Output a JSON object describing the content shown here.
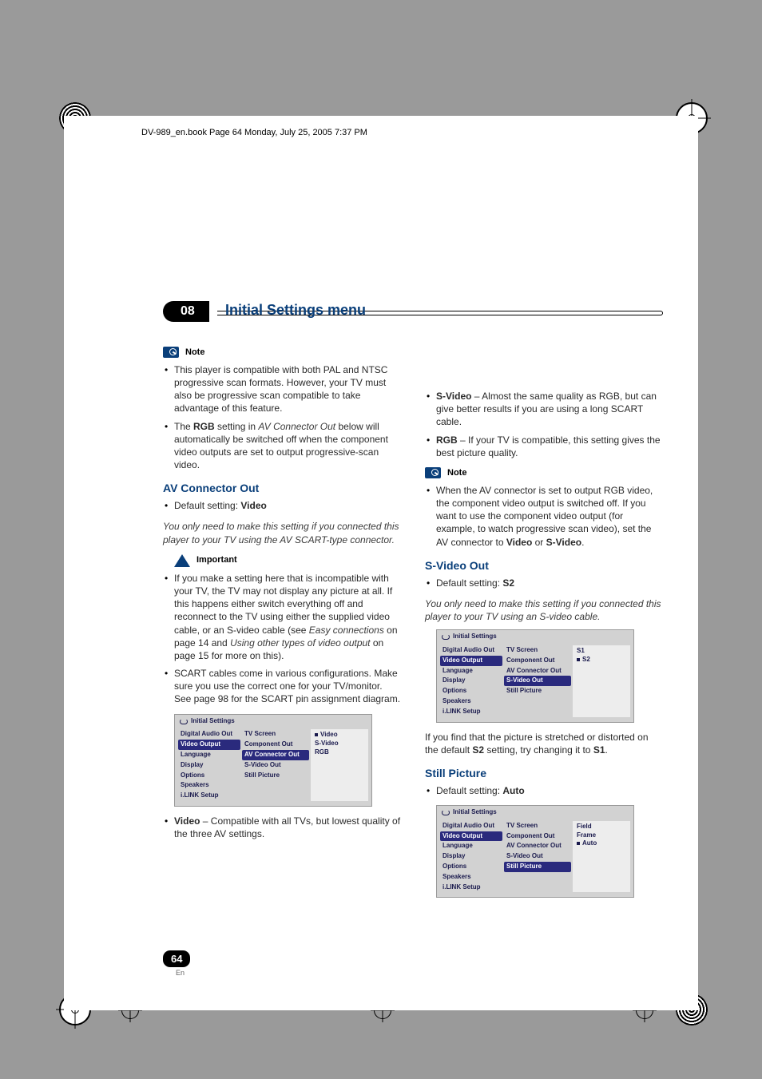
{
  "header_runner": "DV-989_en.book  Page 64  Monday, July 25, 2005  7:37 PM",
  "chapter": {
    "number": "08",
    "title": "Initial Settings menu"
  },
  "page": {
    "number": "64",
    "lang": "En"
  },
  "labels": {
    "note": "Note",
    "important": "Important"
  },
  "left": {
    "note_items": [
      {
        "pre": "This player is compatible with both PAL and NTSC progressive scan formats. However, your TV must also be progressive scan compatible to take advantage of this feature."
      },
      {
        "pre": "The ",
        "b1": "RGB",
        "mid1": " setting in ",
        "i1": "AV Connector Out",
        "post": " below will automatically be switched off when the component video outputs are set to output progressive-scan video."
      }
    ],
    "avc": {
      "heading": "AV Connector Out",
      "default_pre": "Default setting: ",
      "default_val": "Video",
      "italic": "You only need to make this setting if you connected this player to your TV using the AV SCART-type connector.",
      "important_items": [
        {
          "pre": "If you make a setting here that is incompatible with your TV, the TV may not display any picture at all. If this happens either switch everything off and reconnect to the TV using either the supplied video cable, or an S-video cable (see ",
          "i1": "Easy connections",
          "mid1": " on page 14 and ",
          "i2": "Using other types of video output",
          "post": " on page 15 for more on this)."
        },
        {
          "pre": "SCART cables come in various configurations. Make sure you use the correct one for your TV/monitor. See page 98 for the SCART pin assignment diagram."
        }
      ],
      "video_bullet_b": "Video",
      "video_bullet_txt": " – Compatible with all TVs, but lowest quality of the three AV settings."
    }
  },
  "right": {
    "top_items": [
      {
        "b": "S-Video",
        "txt": " – Almost the same quality as RGB, but can give better results if you are using a long SCART cable."
      },
      {
        "b": "RGB",
        "txt": " – If your TV is compatible, this setting gives the best picture quality."
      }
    ],
    "note_item": {
      "pre": "When the AV connector is set to output RGB video, the component video output is switched off. If you want to use the component video output (for example, to watch progressive scan video), set the AV connector to ",
      "b1": "Video",
      "mid": " or ",
      "b2": "S-Video",
      "post": "."
    },
    "svideo": {
      "heading": "S-Video Out",
      "default_pre": "Default setting: ",
      "default_val": "S2",
      "italic": "You only need to make this setting if you connected this player to your TV using an S-video cable.",
      "para_pre": "If you find that the picture is stretched or distorted on the default ",
      "para_b1": "S2",
      "para_mid": " setting, try changing it to ",
      "para_b2": "S1",
      "para_post": "."
    },
    "still": {
      "heading": "Still Picture",
      "default_pre": "Default setting: ",
      "default_val": "Auto"
    }
  },
  "miniui_common": {
    "title": "Initial Settings",
    "left_items": [
      "Digital Audio Out",
      "Video Output",
      "Language",
      "Display",
      "Options",
      "Speakers",
      "i.LINK Setup"
    ],
    "mid_items": [
      "TV Screen",
      "Component Out",
      "AV Connector Out",
      "S-Video Out",
      "Still Picture"
    ]
  },
  "miniui1": {
    "left_selected": 1,
    "mid_selected": 2,
    "right_opts": [
      "Video",
      "S-Video",
      "RGB"
    ],
    "right_dot": 0
  },
  "miniui2": {
    "left_selected": 1,
    "mid_selected": 3,
    "right_opts": [
      "S1",
      "S2"
    ],
    "right_dot": 1
  },
  "miniui3": {
    "left_selected": 1,
    "mid_selected": 4,
    "right_opts": [
      "Field",
      "Frame",
      "Auto"
    ],
    "right_dot": 2
  }
}
